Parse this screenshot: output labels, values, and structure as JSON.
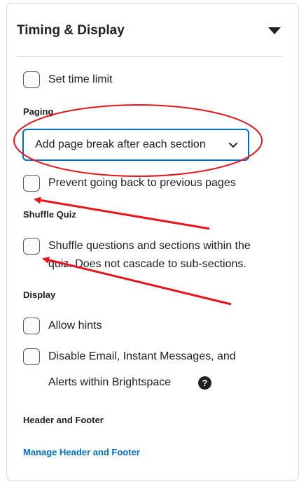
{
  "panel": {
    "title": "Timing & Display",
    "collapse_icon": "caret-down-icon"
  },
  "timing": {
    "set_time_limit_label": "Set time limit"
  },
  "paging": {
    "section_label": "Paging",
    "select_value": "Add page break after each section",
    "prevent_back_label": "Prevent going back to previous pages"
  },
  "shuffle": {
    "section_label": "Shuffle Quiz",
    "shuffle_label_line1": "Shuffle questions and sections within the",
    "shuffle_label_line2": "quiz. Does not cascade to sub-sections."
  },
  "display": {
    "section_label": "Display",
    "allow_hints_label": "Allow hints",
    "disable_email_line1": "Disable Email, Instant Messages, and",
    "disable_email_line2": "Alerts within Brightspace",
    "help_icon_glyph": "?"
  },
  "header_footer": {
    "section_label": "Header and Footer",
    "manage_link": "Manage Header and Footer"
  },
  "colors": {
    "accent": "#006fbf",
    "annotation": "#e8141c",
    "text": "#202122",
    "border": "#d3d9e3"
  }
}
